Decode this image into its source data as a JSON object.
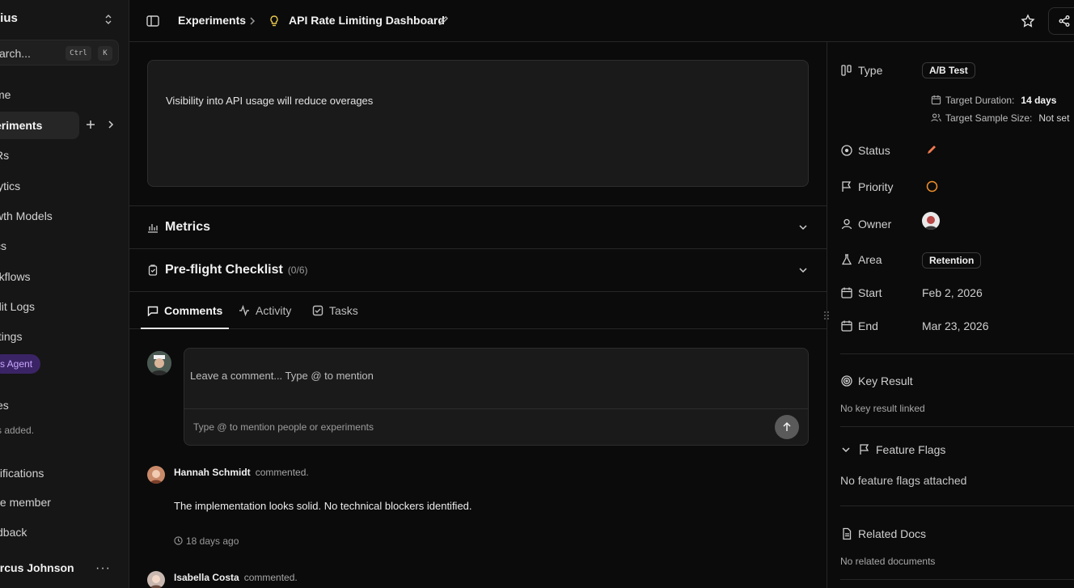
{
  "sidebar": {
    "workspace": "lius",
    "search_placeholder": "arch...",
    "shortcut_ctrl": "Ctrl",
    "shortcut_k": "K",
    "nav": [
      {
        "label": "me"
      },
      {
        "label": "eriments",
        "active": true
      },
      {
        "label": "Rs"
      },
      {
        "label": "lytics"
      },
      {
        "label": "wth Models"
      },
      {
        "label": "cs"
      },
      {
        "label": "rkflows"
      },
      {
        "label": "dit Logs"
      },
      {
        "label": "ttings"
      }
    ],
    "agent_pill": "s Agent",
    "section_title": "es",
    "section_empty": "s added.",
    "notifications": "tifications",
    "invite": "te member",
    "feedback": "dback",
    "user_name": "arcus Johnson",
    "more": "···"
  },
  "topbar": {
    "crumb_parent": "Experiments",
    "crumb_current": "API Rate Limiting Dashboard"
  },
  "main": {
    "hypothesis": "Visibility into API usage will reduce overages",
    "metrics_title": "Metrics",
    "checklist_title": "Pre-flight Checklist",
    "checklist_count": "(0/6)",
    "tabs": [
      {
        "label": "Comments",
        "active": true
      },
      {
        "label": "Activity"
      },
      {
        "label": "Tasks"
      }
    ],
    "comment_box": {
      "placeholder": "Leave a comment... Type @ to mention",
      "hint": "Type @ to mention people or experiments"
    },
    "comments": [
      {
        "author": "Hannah Schmidt",
        "verb": "commented.",
        "body": "The implementation looks solid. No technical blockers identified.",
        "time": "18 days ago"
      },
      {
        "author": "Isabella Costa",
        "verb": "commented."
      }
    ]
  },
  "details": {
    "type_label": "Type",
    "type_value": "A/B Test",
    "target_duration_label": "Target Duration:",
    "target_duration_value": "14 days",
    "target_sample_label": "Target Sample Size:",
    "target_sample_value": "Not set",
    "status_label": "Status",
    "priority_label": "Priority",
    "owner_label": "Owner",
    "area_label": "Area",
    "area_value": "Retention",
    "start_label": "Start",
    "start_value": "Feb 2, 2026",
    "end_label": "End",
    "end_value": "Mar 23, 2026",
    "key_result_label": "Key Result",
    "key_result_empty": "No key result linked",
    "feature_flags_label": "Feature Flags",
    "feature_flags_empty": "No feature flags attached",
    "related_docs_label": "Related Docs",
    "related_docs_empty": "No related documents"
  },
  "colors": {
    "accent_status": "#f07a4f",
    "priority_ring": "#f0902a",
    "agent_pill_bg": "#3b2466"
  }
}
